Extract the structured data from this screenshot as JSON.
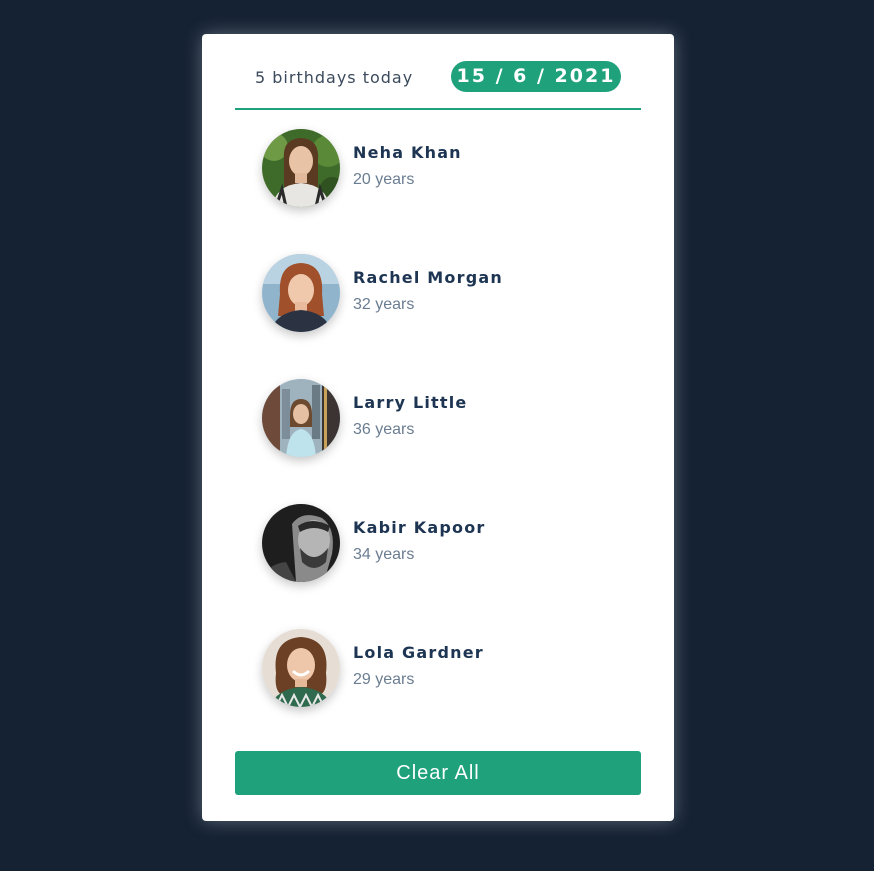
{
  "header": {
    "birthday_count": "5 birthdays today",
    "date": "15 / 6 / 2021"
  },
  "people": [
    {
      "name": "Neha Khan",
      "age": "20 years"
    },
    {
      "name": "Rachel Morgan",
      "age": "32 years"
    },
    {
      "name": "Larry Little",
      "age": "36 years"
    },
    {
      "name": "Kabir Kapoor",
      "age": "34 years"
    },
    {
      "name": "Lola Gardner",
      "age": "29 years"
    }
  ],
  "actions": {
    "clear_label": "Clear All"
  },
  "colors": {
    "background": "#152233",
    "accent": "#1fa27b",
    "name_text": "#1d3552",
    "age_text": "#6b7d91"
  }
}
